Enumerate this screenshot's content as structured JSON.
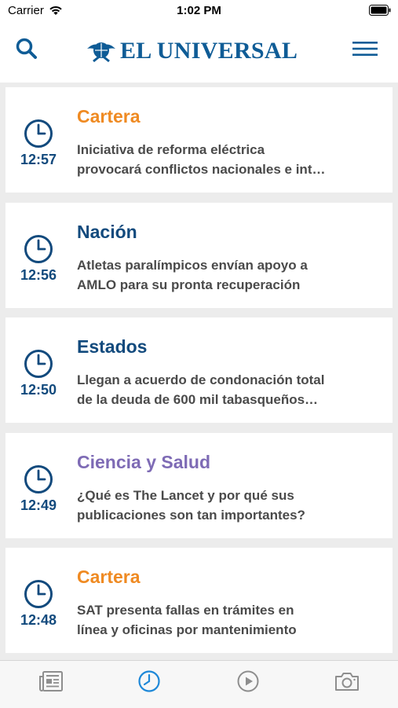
{
  "status_bar": {
    "carrier": "Carrier",
    "time": "1:02 PM"
  },
  "header": {
    "logo_text": "EL UNIVERSAL"
  },
  "colors": {
    "brand": "#0f5c96",
    "orange": "#ef8a22",
    "purple": "#7e6bb5",
    "blue": "#124a7d"
  },
  "feed": [
    {
      "time": "12:57",
      "section": "Cartera",
      "section_color": "#ef8a22",
      "line1": "Iniciativa de reforma eléctrica",
      "line2": "provocará conflictos nacionales e int…"
    },
    {
      "time": "12:56",
      "section": "Nación",
      "section_color": "#124a7d",
      "line1": "Atletas paralímpicos envían apoyo a",
      "line2": "AMLO para su pronta recuperación"
    },
    {
      "time": "12:50",
      "section": "Estados",
      "section_color": "#124a7d",
      "line1": "Llegan a acuerdo de condonación total",
      "line2": "de la deuda de 600 mil tabasqueños…"
    },
    {
      "time": "12:49",
      "section": "Ciencia y Salud",
      "section_color": "#7e6bb5",
      "line1": "¿Qué es The Lancet y por qué sus",
      "line2": "publicaciones son tan importantes?"
    },
    {
      "time": "12:48",
      "section": "Cartera",
      "section_color": "#ef8a22",
      "line1": "SAT presenta fallas en trámites en",
      "line2": "línea y oficinas por mantenimiento"
    }
  ],
  "tabbar": [
    {
      "icon": "newspaper-icon",
      "active": false
    },
    {
      "icon": "clock-icon",
      "active": true
    },
    {
      "icon": "play-icon",
      "active": false
    },
    {
      "icon": "camera-icon",
      "active": false
    }
  ]
}
